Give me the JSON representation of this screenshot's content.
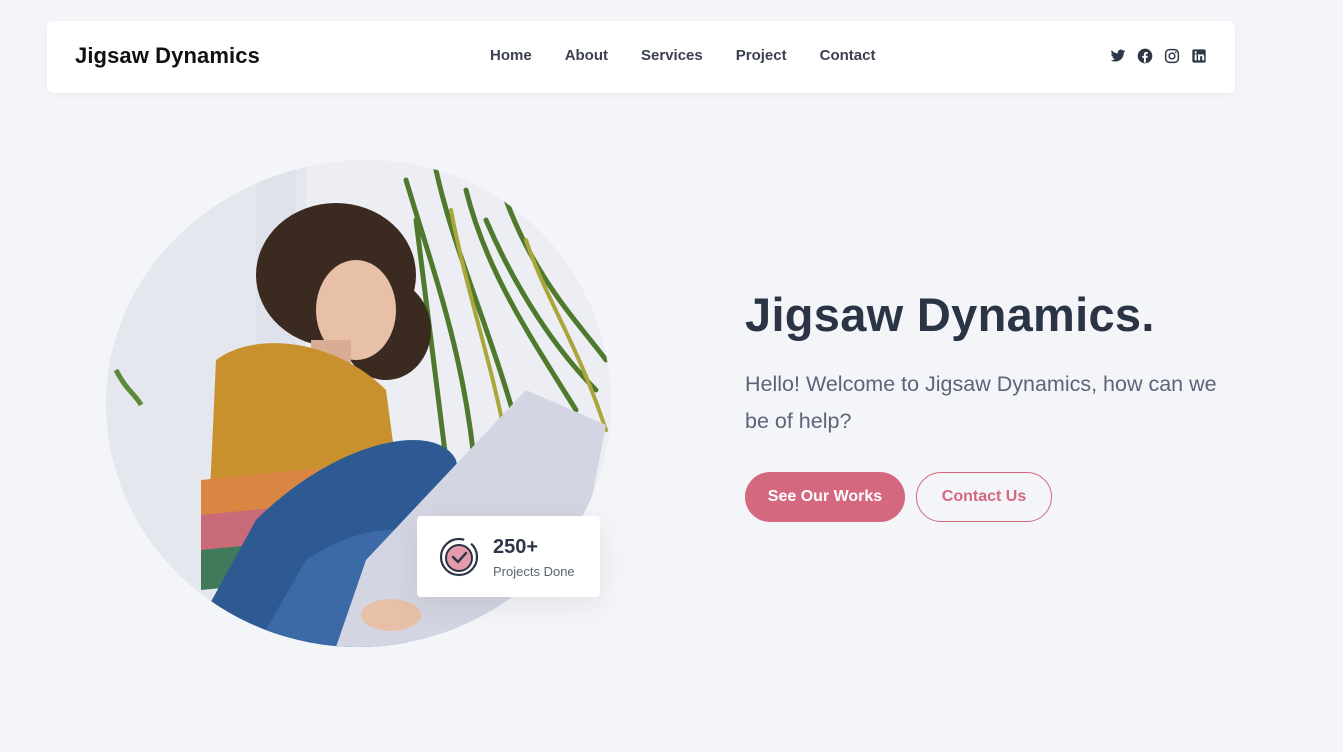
{
  "header": {
    "brand": "Jigsaw Dynamics",
    "nav": [
      {
        "label": "Home"
      },
      {
        "label": "About"
      },
      {
        "label": "Services"
      },
      {
        "label": "Project"
      },
      {
        "label": "Contact"
      }
    ],
    "socials": [
      {
        "icon": "twitter-icon"
      },
      {
        "icon": "facebook-icon"
      },
      {
        "icon": "instagram-icon"
      },
      {
        "icon": "linkedin-icon"
      }
    ]
  },
  "hero": {
    "title": "Jigsaw Dynamics.",
    "subtitle": "Hello! Welcome to Jigsaw Dynamics, how can we be of help?",
    "primary_button": "See Our Works",
    "secondary_button": "Contact Us",
    "stat": {
      "value": "250+",
      "label": "Projects Done"
    }
  },
  "colors": {
    "accent": "#d3687f",
    "text_dark": "#2b3445",
    "text_muted": "#5b6478",
    "background": "#f4f5f8"
  }
}
